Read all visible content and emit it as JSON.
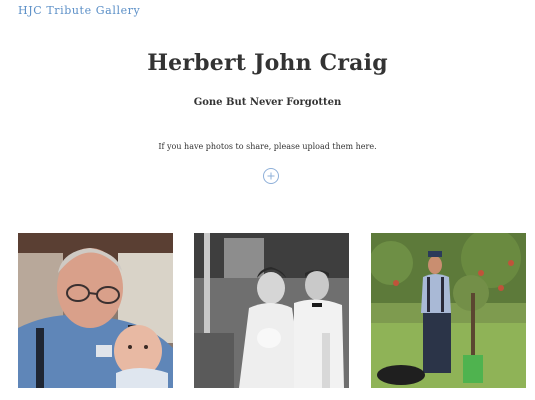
{
  "site": {
    "title": "HJC Tribute Gallery"
  },
  "main": {
    "title": "Herbert John Craig",
    "subtitle": "Gone But Never Forgotten",
    "upload_text": "If you have photos to share, please upload them here.",
    "upload_icon": "plus-circle-icon"
  },
  "gallery": {
    "photos": [
      {
        "subject": "elderly man with glasses holding a baby"
      },
      {
        "subject": "black and white wedding photo of bride and groom"
      },
      {
        "subject": "man in cap standing in an apple orchard"
      }
    ]
  },
  "colors": {
    "link": "#5b8fc7",
    "text": "#333333",
    "upload_circle": "#8fb0d9"
  }
}
